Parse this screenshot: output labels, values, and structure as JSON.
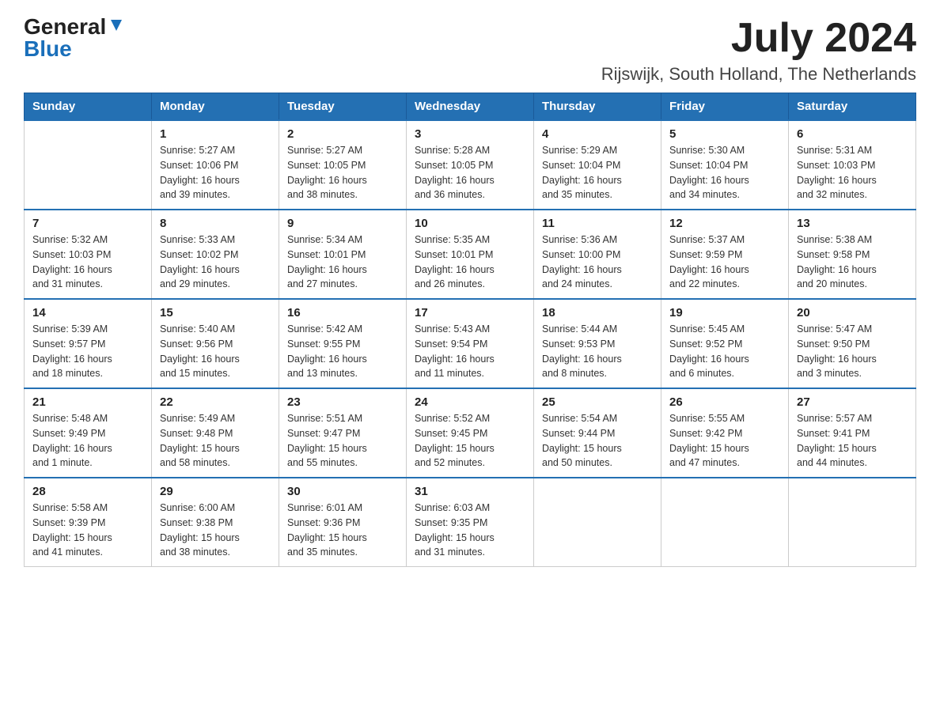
{
  "logo": {
    "general": "General",
    "blue": "Blue"
  },
  "title": "July 2024",
  "location": "Rijswijk, South Holland, The Netherlands",
  "days_of_week": [
    "Sunday",
    "Monday",
    "Tuesday",
    "Wednesday",
    "Thursday",
    "Friday",
    "Saturday"
  ],
  "weeks": [
    [
      {
        "day": "",
        "info": ""
      },
      {
        "day": "1",
        "info": "Sunrise: 5:27 AM\nSunset: 10:06 PM\nDaylight: 16 hours\nand 39 minutes."
      },
      {
        "day": "2",
        "info": "Sunrise: 5:27 AM\nSunset: 10:05 PM\nDaylight: 16 hours\nand 38 minutes."
      },
      {
        "day": "3",
        "info": "Sunrise: 5:28 AM\nSunset: 10:05 PM\nDaylight: 16 hours\nand 36 minutes."
      },
      {
        "day": "4",
        "info": "Sunrise: 5:29 AM\nSunset: 10:04 PM\nDaylight: 16 hours\nand 35 minutes."
      },
      {
        "day": "5",
        "info": "Sunrise: 5:30 AM\nSunset: 10:04 PM\nDaylight: 16 hours\nand 34 minutes."
      },
      {
        "day": "6",
        "info": "Sunrise: 5:31 AM\nSunset: 10:03 PM\nDaylight: 16 hours\nand 32 minutes."
      }
    ],
    [
      {
        "day": "7",
        "info": "Sunrise: 5:32 AM\nSunset: 10:03 PM\nDaylight: 16 hours\nand 31 minutes."
      },
      {
        "day": "8",
        "info": "Sunrise: 5:33 AM\nSunset: 10:02 PM\nDaylight: 16 hours\nand 29 minutes."
      },
      {
        "day": "9",
        "info": "Sunrise: 5:34 AM\nSunset: 10:01 PM\nDaylight: 16 hours\nand 27 minutes."
      },
      {
        "day": "10",
        "info": "Sunrise: 5:35 AM\nSunset: 10:01 PM\nDaylight: 16 hours\nand 26 minutes."
      },
      {
        "day": "11",
        "info": "Sunrise: 5:36 AM\nSunset: 10:00 PM\nDaylight: 16 hours\nand 24 minutes."
      },
      {
        "day": "12",
        "info": "Sunrise: 5:37 AM\nSunset: 9:59 PM\nDaylight: 16 hours\nand 22 minutes."
      },
      {
        "day": "13",
        "info": "Sunrise: 5:38 AM\nSunset: 9:58 PM\nDaylight: 16 hours\nand 20 minutes."
      }
    ],
    [
      {
        "day": "14",
        "info": "Sunrise: 5:39 AM\nSunset: 9:57 PM\nDaylight: 16 hours\nand 18 minutes."
      },
      {
        "day": "15",
        "info": "Sunrise: 5:40 AM\nSunset: 9:56 PM\nDaylight: 16 hours\nand 15 minutes."
      },
      {
        "day": "16",
        "info": "Sunrise: 5:42 AM\nSunset: 9:55 PM\nDaylight: 16 hours\nand 13 minutes."
      },
      {
        "day": "17",
        "info": "Sunrise: 5:43 AM\nSunset: 9:54 PM\nDaylight: 16 hours\nand 11 minutes."
      },
      {
        "day": "18",
        "info": "Sunrise: 5:44 AM\nSunset: 9:53 PM\nDaylight: 16 hours\nand 8 minutes."
      },
      {
        "day": "19",
        "info": "Sunrise: 5:45 AM\nSunset: 9:52 PM\nDaylight: 16 hours\nand 6 minutes."
      },
      {
        "day": "20",
        "info": "Sunrise: 5:47 AM\nSunset: 9:50 PM\nDaylight: 16 hours\nand 3 minutes."
      }
    ],
    [
      {
        "day": "21",
        "info": "Sunrise: 5:48 AM\nSunset: 9:49 PM\nDaylight: 16 hours\nand 1 minute."
      },
      {
        "day": "22",
        "info": "Sunrise: 5:49 AM\nSunset: 9:48 PM\nDaylight: 15 hours\nand 58 minutes."
      },
      {
        "day": "23",
        "info": "Sunrise: 5:51 AM\nSunset: 9:47 PM\nDaylight: 15 hours\nand 55 minutes."
      },
      {
        "day": "24",
        "info": "Sunrise: 5:52 AM\nSunset: 9:45 PM\nDaylight: 15 hours\nand 52 minutes."
      },
      {
        "day": "25",
        "info": "Sunrise: 5:54 AM\nSunset: 9:44 PM\nDaylight: 15 hours\nand 50 minutes."
      },
      {
        "day": "26",
        "info": "Sunrise: 5:55 AM\nSunset: 9:42 PM\nDaylight: 15 hours\nand 47 minutes."
      },
      {
        "day": "27",
        "info": "Sunrise: 5:57 AM\nSunset: 9:41 PM\nDaylight: 15 hours\nand 44 minutes."
      }
    ],
    [
      {
        "day": "28",
        "info": "Sunrise: 5:58 AM\nSunset: 9:39 PM\nDaylight: 15 hours\nand 41 minutes."
      },
      {
        "day": "29",
        "info": "Sunrise: 6:00 AM\nSunset: 9:38 PM\nDaylight: 15 hours\nand 38 minutes."
      },
      {
        "day": "30",
        "info": "Sunrise: 6:01 AM\nSunset: 9:36 PM\nDaylight: 15 hours\nand 35 minutes."
      },
      {
        "day": "31",
        "info": "Sunrise: 6:03 AM\nSunset: 9:35 PM\nDaylight: 15 hours\nand 31 minutes."
      },
      {
        "day": "",
        "info": ""
      },
      {
        "day": "",
        "info": ""
      },
      {
        "day": "",
        "info": ""
      }
    ]
  ]
}
